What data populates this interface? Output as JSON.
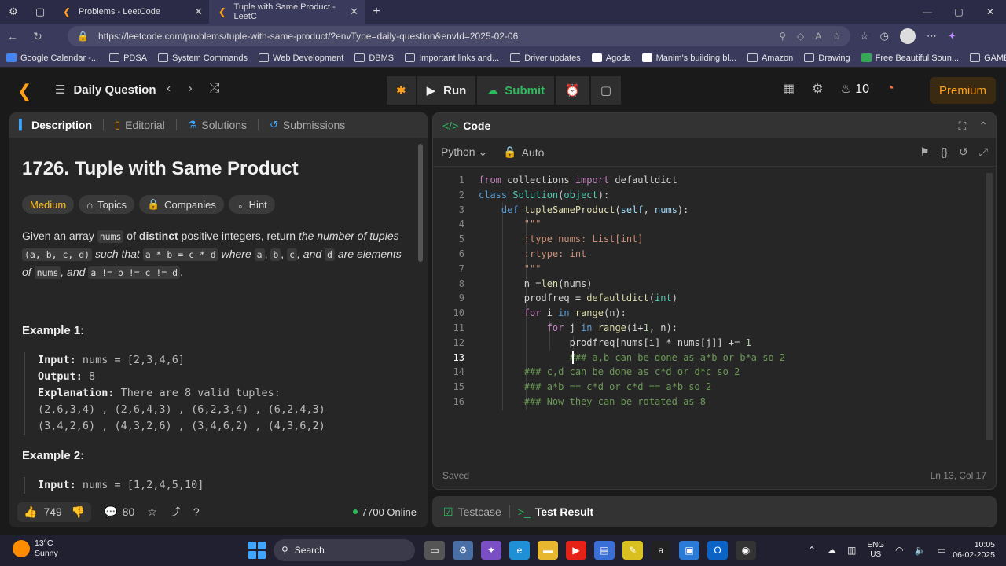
{
  "browser": {
    "tabs": [
      {
        "title": "Problems - LeetCode"
      },
      {
        "title": "Tuple with Same Product - LeetC"
      }
    ],
    "url": "https://leetcode.com/problems/tuple-with-same-product/?envType=daily-question&envId=2025-02-06",
    "bookmarks": [
      "Google Calendar -...",
      "PDSA",
      "System Commands",
      "Web Development",
      "DBMS",
      "Important links and...",
      "Driver updates",
      "Agoda",
      "Manim's building bl...",
      "Amazon",
      "Drawing",
      "Free Beautiful Soun...",
      "GAME"
    ]
  },
  "nav": {
    "daily_question": "Daily Question",
    "run": "Run",
    "submit": "Submit",
    "streak": "10",
    "premium": "Premium"
  },
  "left": {
    "tabs": [
      "Description",
      "Editorial",
      "Solutions",
      "Submissions"
    ],
    "title": "1726. Tuple with Same Product",
    "chips": [
      "Medium",
      "Topics",
      "Companies",
      "Hint"
    ],
    "desc_p1": "Given an array ",
    "desc_code_nums": "nums",
    "desc_p2": " of ",
    "desc_distinct": "distinct",
    "desc_p3": " positive integers, return ",
    "desc_i1": "the number of tuples ",
    "desc_code_tuple": "(a, b, c, d)",
    "desc_i2": " such that ",
    "desc_code_eq": "a * b = c * d",
    "desc_i3": " where ",
    "desc_code_a": "a",
    "desc_comma1": ", ",
    "desc_code_b": "b",
    "desc_comma2": ", ",
    "desc_code_c": "c",
    "desc_i4": ", and ",
    "desc_code_d": "d",
    "desc_i5": " are elements of ",
    "desc_code_nums2": "nums",
    "desc_i6": ", and ",
    "desc_code_neq": "a != b != c != d",
    "desc_end": ".",
    "example1_header": "Example 1:",
    "example1_input_label": "Input:",
    "example1_input": " nums = [2,3,4,6]",
    "example1_output_label": "Output:",
    "example1_output": " 8",
    "example1_expl_label": "Explanation:",
    "example1_expl": " There are 8 valid tuples:",
    "example1_line1": "(2,6,3,4) , (2,6,4,3) , (6,2,3,4) , (6,2,4,3)",
    "example1_line2": "(3,4,2,6) , (4,3,2,6) , (3,4,6,2) , (4,3,6,2)",
    "example2_header": "Example 2:",
    "example2_input_label": "Input:",
    "example2_input": " nums = [1,2,4,5,10]",
    "likes": "749",
    "comments": "80",
    "online": "7700 Online"
  },
  "code": {
    "header": "Code",
    "language": "Python",
    "mode": "Auto",
    "status": "Saved",
    "cursor": "Ln 13, Col 17",
    "current_line": 13
  },
  "test": {
    "tabs": [
      "Testcase",
      "Test Result"
    ]
  },
  "taskbar": {
    "temp": "13°C",
    "weather": "Sunny",
    "search": "Search",
    "lang1": "ENG",
    "lang2": "US",
    "time": "10:05",
    "date": "06-02-2025"
  }
}
